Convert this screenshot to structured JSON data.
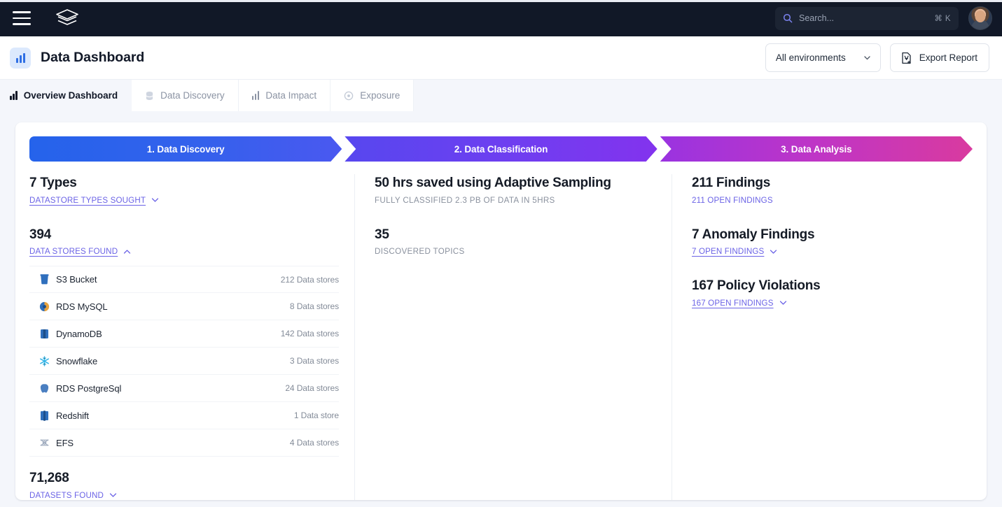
{
  "topnav": {
    "menu_icon": "hamburger-icon",
    "logo_icon": "layers-logo-icon",
    "search": {
      "placeholder": "Search...",
      "value": "",
      "icon": "search-icon",
      "shortcut": "⌘ K"
    },
    "avatar_alt": "user-avatar"
  },
  "header": {
    "title": "Data Dashboard",
    "title_icon": "bar-chart-icon",
    "environment_select": {
      "value": "All environments",
      "chevron": "chevron-down-icon"
    },
    "export_button": {
      "label": "Export Report",
      "icon": "export-document-icon"
    }
  },
  "tabs": [
    {
      "label": "Overview Dashboard",
      "icon": "bar-chart-icon",
      "active": true
    },
    {
      "label": "Data Discovery",
      "icon": "database-icon",
      "active": false
    },
    {
      "label": "Data Impact",
      "icon": "bar-chart-icon",
      "active": false
    },
    {
      "label": "Exposure",
      "icon": "eye-target-icon",
      "active": false
    }
  ],
  "pipeline": {
    "steps": [
      {
        "label": "1. Data Discovery",
        "color_start": "#2563eb",
        "color_end": "#4a58f0"
      },
      {
        "label": "2. Data Classification",
        "color_start": "#5747ef",
        "color_end": "#8333ee"
      },
      {
        "label": "3. Data Analysis",
        "color_start": "#9a33e0",
        "color_end": "#d93a9f"
      }
    ]
  },
  "columns": {
    "discovery": {
      "types_metric": {
        "value": "7 Types",
        "link": "DATASTORE TYPES SOUGHT",
        "expanded": false
      },
      "stores_metric": {
        "value": "394",
        "link": "DATA STORES FOUND",
        "expanded": true
      },
      "datastores": [
        {
          "name": "S3 Bucket",
          "count": "212 Data stores",
          "icon": "s3-bucket-icon",
          "color": "#2f6fbd"
        },
        {
          "name": "RDS MySQL",
          "count": "8 Data stores",
          "icon": "rds-mysql-icon",
          "color": "#e8a33d"
        },
        {
          "name": "DynamoDB",
          "count": "142 Data stores",
          "icon": "dynamodb-icon",
          "color": "#2f6fbd"
        },
        {
          "name": "Snowflake",
          "count": "3 Data stores",
          "icon": "snowflake-icon",
          "color": "#35b6e8"
        },
        {
          "name": "RDS PostgreSql",
          "count": "24 Data stores",
          "icon": "rds-postgres-icon",
          "color": "#4a7fc1"
        },
        {
          "name": "Redshift",
          "count": "1 Data store",
          "icon": "redshift-icon",
          "color": "#2f6fbd"
        },
        {
          "name": "EFS",
          "count": "4 Data stores",
          "icon": "efs-icon",
          "color": "#9aa7bb"
        }
      ],
      "datasets_metric": {
        "value": "71,268",
        "link": "DATASETS FOUND",
        "expanded": false
      }
    },
    "classification": {
      "saved_metric": {
        "value": "50 hrs saved using Adaptive Sampling",
        "sub": "FULLY CLASSIFIED 2.3 PB OF DATA IN 5HRS"
      },
      "topics_metric": {
        "value": "35",
        "sub": "DISCOVERED TOPICS"
      }
    },
    "analysis": {
      "findings_metric": {
        "value": "211 Findings",
        "link": "211 OPEN FINDINGS",
        "expandable": false
      },
      "anomaly_metric": {
        "value": "7 Anomaly Findings",
        "link": "7 OPEN FINDINGS",
        "expandable": true
      },
      "policy_metric": {
        "value": "167 Policy Violations",
        "link": "167 OPEN FINDINGS",
        "expandable": true
      }
    }
  }
}
